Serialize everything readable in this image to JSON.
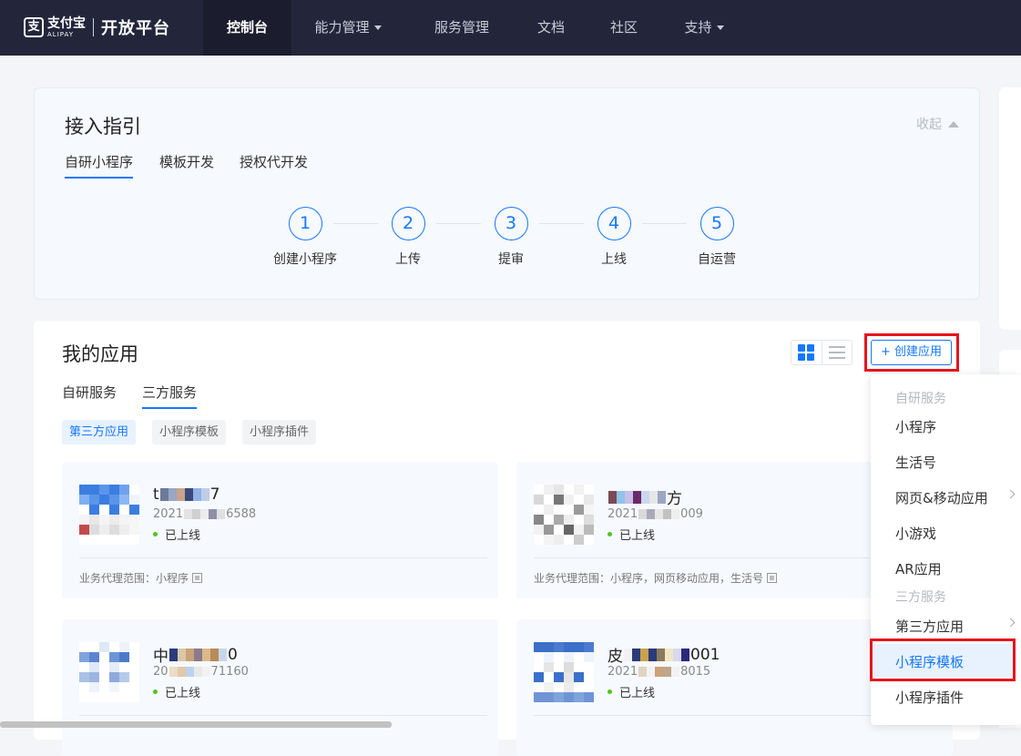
{
  "nav": {
    "logo_cn": "支付宝",
    "logo_en": "ALIPAY",
    "logo_title": "开放平台",
    "items": [
      {
        "label": "控制台",
        "active": true
      },
      {
        "label": "能力管理",
        "dropdown": true
      },
      {
        "label": "服务管理"
      },
      {
        "label": "文档"
      },
      {
        "label": "社区"
      },
      {
        "label": "支持",
        "dropdown": true
      }
    ]
  },
  "guide": {
    "title": "接入指引",
    "collapse_label": "收起",
    "tabs": [
      "自研小程序",
      "模板开发",
      "授权代开发"
    ],
    "steps": [
      {
        "num": "1",
        "label": "创建小程序"
      },
      {
        "num": "2",
        "label": "上传"
      },
      {
        "num": "3",
        "label": "提审"
      },
      {
        "num": "4",
        "label": "上线"
      },
      {
        "num": "5",
        "label": "自运营"
      }
    ]
  },
  "apps": {
    "title": "我的应用",
    "create_label": "+ 创建应用",
    "tabs": [
      "自研服务",
      "三方服务"
    ],
    "chips": [
      "第三方应用",
      "小程序模板",
      "小程序插件"
    ],
    "cards": [
      {
        "name_pre": "t",
        "name_post": "7",
        "id_pre": "2021",
        "id_post": "6588",
        "status": "已上线",
        "scope": "业务代理范围：小程序"
      },
      {
        "name_pre": "",
        "name_post": "方",
        "id_pre": "2021",
        "id_post": "009",
        "status": "已上线",
        "scope": "业务代理范围：小程序，网页移动应用，生活号"
      },
      {
        "name_pre": "中",
        "name_post": "0",
        "id_pre": "20",
        "id_post": "71160",
        "status": "已上线",
        "scope": ""
      },
      {
        "name_pre": "皮",
        "name_post": "001",
        "id_pre": "2021",
        "id_post": "8015",
        "status": "已上线",
        "scope": ""
      }
    ]
  },
  "dropdown": {
    "group1": "自研服务",
    "items1": [
      "小程序",
      "生活号",
      "网页&移动应用",
      "小游戏",
      "AR应用"
    ],
    "group2": "三方服务",
    "items2": [
      "第三方应用",
      "小程序模板",
      "小程序插件"
    ]
  },
  "colors": {
    "accent": "#1677ff",
    "nav_bg": "#23263b",
    "highlight_red": "#e8141c",
    "online_green": "#52c41a"
  }
}
